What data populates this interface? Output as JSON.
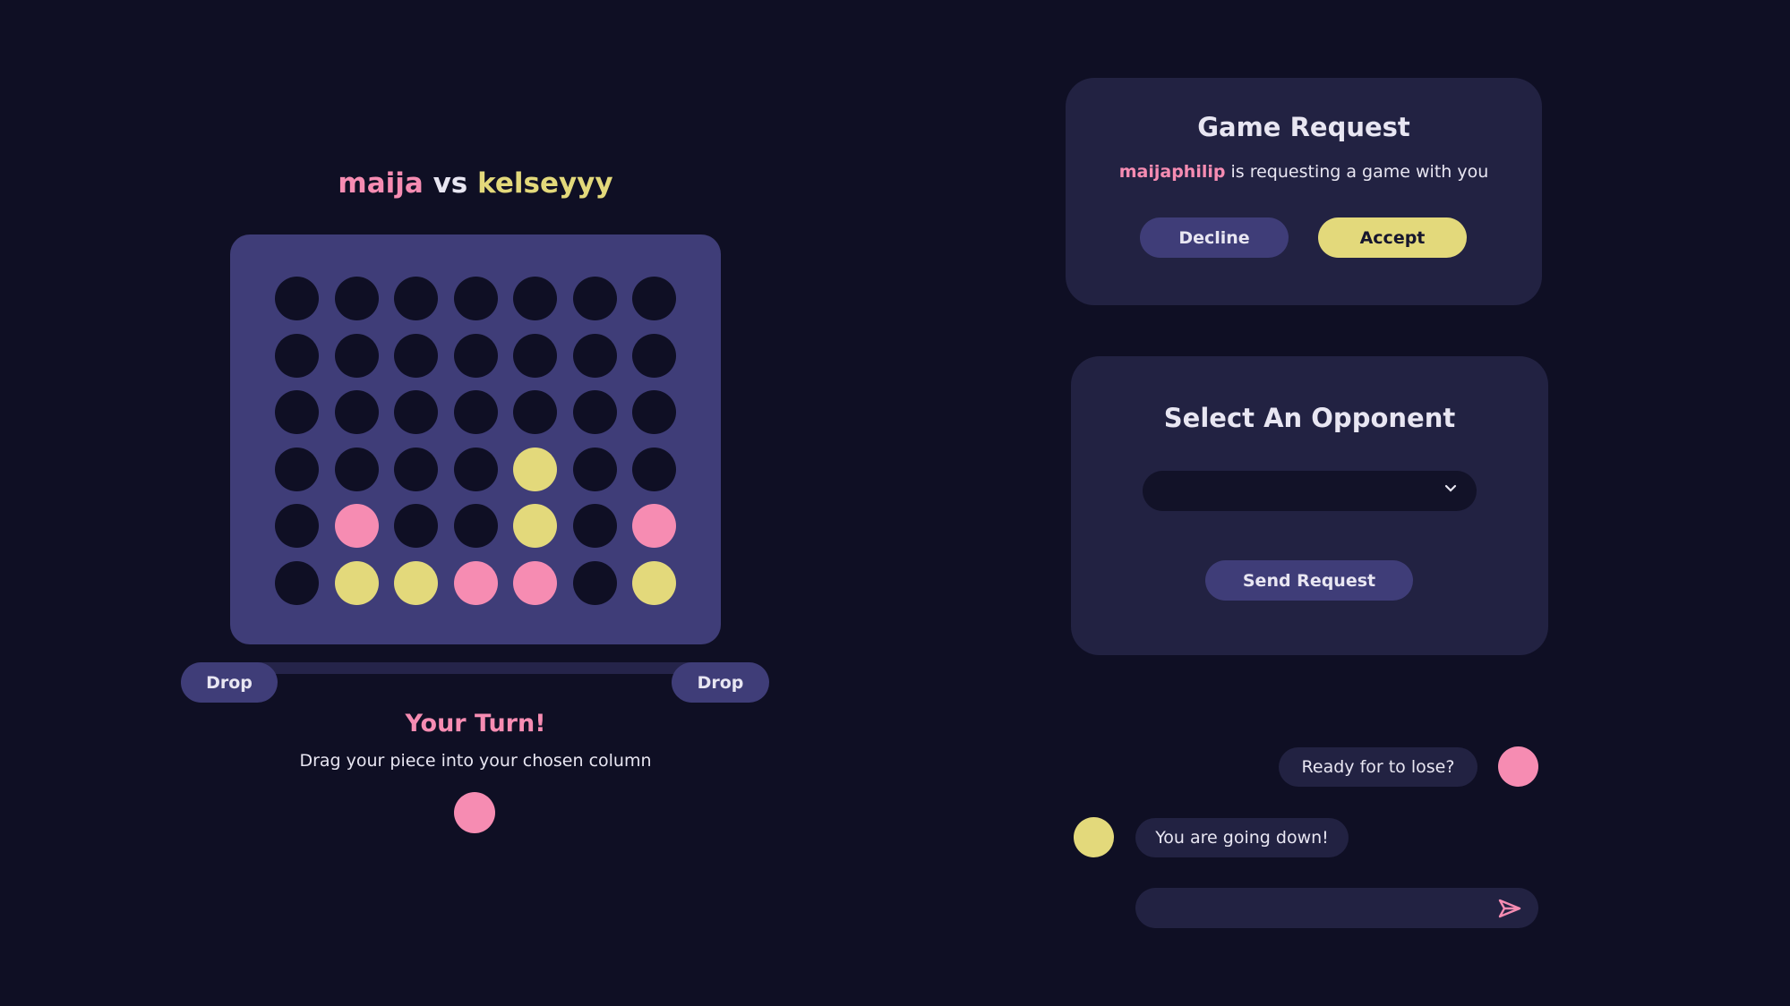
{
  "match": {
    "player1": "maija",
    "vs": "vs",
    "player2": "kelseyyy"
  },
  "board": {
    "rows": [
      [
        "e",
        "e",
        "e",
        "e",
        "e",
        "e",
        "e"
      ],
      [
        "e",
        "e",
        "e",
        "e",
        "e",
        "e",
        "e"
      ],
      [
        "e",
        "e",
        "e",
        "e",
        "e",
        "e",
        "e"
      ],
      [
        "e",
        "e",
        "e",
        "e",
        "y",
        "e",
        "e"
      ],
      [
        "e",
        "p",
        "e",
        "e",
        "y",
        "e",
        "p"
      ],
      [
        "e",
        "y",
        "y",
        "p",
        "p",
        "e",
        "y"
      ]
    ]
  },
  "controls": {
    "drop_left": "Drop",
    "drop_right": "Drop"
  },
  "turn": {
    "title": "Your Turn!",
    "subtitle": "Drag your piece into your chosen column"
  },
  "game_request": {
    "title": "Game Request",
    "requester": "maijaphilip",
    "message": " is requesting a game with you",
    "decline": "Decline",
    "accept": "Accept"
  },
  "opponent": {
    "title": "Select An Opponent",
    "selected": "",
    "send": "Send Request",
    "chevron_icon": "chevron-down-icon"
  },
  "chat": {
    "messages": [
      {
        "text": "Ready for to lose?",
        "from": "self"
      },
      {
        "text": "You are going down!",
        "from": "opponent"
      }
    ],
    "input_value": "",
    "send_icon": "send-icon"
  },
  "colors": {
    "background": "#0f0f24",
    "board": "#3f3d78",
    "pink": "#f68cb2",
    "yellow": "#e3d97b",
    "card": "#222242"
  }
}
